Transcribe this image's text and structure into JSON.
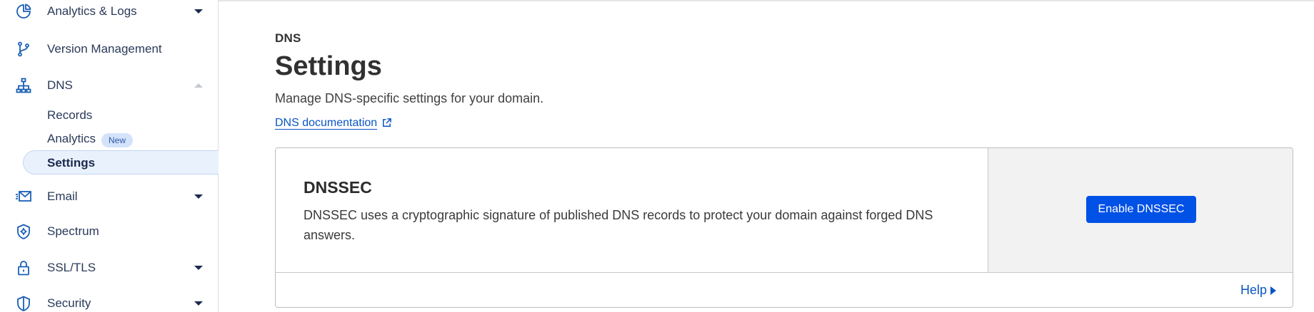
{
  "sidebar": {
    "items": [
      {
        "label": "Analytics & Logs",
        "icon": "pie-chart-icon",
        "has_caret": true
      },
      {
        "label": "Version Management",
        "icon": "branch-icon",
        "has_caret": false
      },
      {
        "label": "DNS",
        "icon": "sitemap-icon",
        "expanded": true
      },
      {
        "label": "Email",
        "icon": "envelope-icon",
        "has_caret": true
      },
      {
        "label": "Spectrum",
        "icon": "spectrum-shield-icon",
        "has_caret": false
      },
      {
        "label": "SSL/TLS",
        "icon": "lock-icon",
        "has_caret": true
      },
      {
        "label": "Security",
        "icon": "shield-icon",
        "has_caret": true
      }
    ],
    "dns_sub": [
      {
        "label": "Records"
      },
      {
        "label": "Analytics",
        "badge": "New"
      },
      {
        "label": "Settings",
        "active": true
      }
    ]
  },
  "main": {
    "eyebrow": "DNS",
    "title": "Settings",
    "subtitle": "Manage DNS-specific settings for your domain.",
    "doc_link": "DNS documentation"
  },
  "card": {
    "title": "DNSSEC",
    "description": "DNSSEC uses a cryptographic signature of published DNS records to protect your domain against forged DNS answers.",
    "button": "Enable DNSSEC",
    "help": "Help"
  },
  "colors": {
    "accent": "#0051e6",
    "link": "#0a55c4",
    "icon": "#1a5fb4",
    "active_bg": "#e9f1fd",
    "side_panel_bg": "#f2f2f2"
  }
}
